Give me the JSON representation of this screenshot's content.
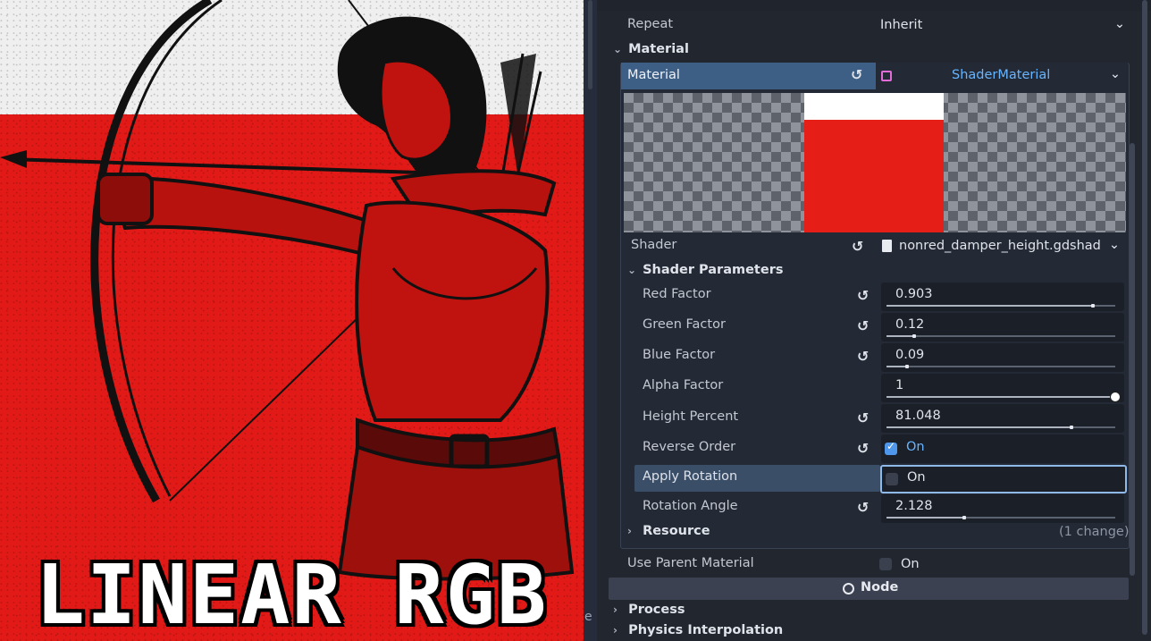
{
  "canvas": {
    "title": "LINEAR RGB",
    "colors": {
      "red": "#e21a17",
      "white_band": "#efefef"
    }
  },
  "divider": {
    "edge_char": "e"
  },
  "inspector": {
    "repeat": {
      "label": "Repeat",
      "value": "Inherit"
    },
    "material_section": {
      "label": "Material"
    },
    "material": {
      "label": "Material",
      "value": "ShaderMaterial"
    },
    "shader": {
      "label": "Shader",
      "value": "nonred_damper_height.gdshad"
    },
    "shader_parameters": {
      "label": "Shader Parameters"
    },
    "params": {
      "red_factor": {
        "label": "Red Factor",
        "value": "0.903",
        "fraction": 0.903
      },
      "green_factor": {
        "label": "Green Factor",
        "value": "0.12",
        "fraction": 0.12
      },
      "blue_factor": {
        "label": "Blue Factor",
        "value": "0.09",
        "fraction": 0.09
      },
      "alpha_factor": {
        "label": "Alpha Factor",
        "value": "1",
        "fraction": 1.0
      },
      "height_percent": {
        "label": "Height Percent",
        "value": "81.048",
        "fraction": 0.81
      },
      "reverse_order": {
        "label": "Reverse Order",
        "value": "On",
        "checked": true
      },
      "apply_rotation": {
        "label": "Apply Rotation",
        "value": "On",
        "checked": false
      },
      "rotation_angle": {
        "label": "Rotation Angle",
        "value": "2.128",
        "fraction": 0.34
      }
    },
    "resource": {
      "label": "Resource",
      "changes": "(1 change)"
    },
    "use_parent_material": {
      "label": "Use Parent Material",
      "value": "On"
    },
    "node_header": {
      "label": "Node"
    },
    "process": {
      "label": "Process"
    },
    "physics_interpolation": {
      "label": "Physics Interpolation"
    },
    "colors": {
      "selected_row": "#3d5f86",
      "accent_text": "#68b5ff",
      "preview_red": "#e51e17"
    }
  }
}
